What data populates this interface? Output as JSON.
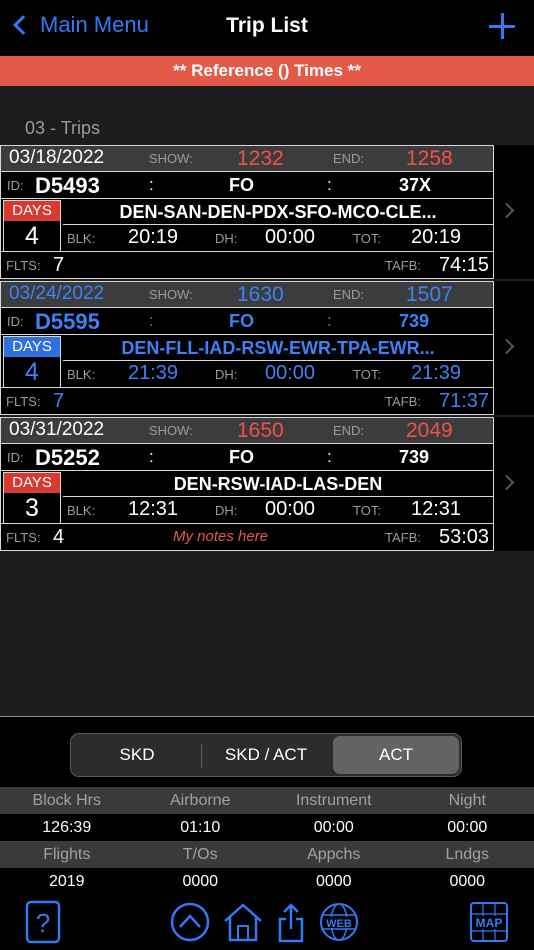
{
  "nav": {
    "back_label": "Main Menu",
    "title": "Trip List",
    "add_icon": "plus-icon"
  },
  "banner": "** Reference () Times **",
  "section_header": "03 - Trips",
  "trips": [
    {
      "date": "03/18/2022",
      "show_label": "SHOW:",
      "show": "1232",
      "end_label": "END:",
      "end": "1258",
      "id_label": "ID:",
      "id": "D5493",
      "colon": ":",
      "position": "FO",
      "equipment": "37X",
      "days_label": "DAYS",
      "days": "4",
      "route": "DEN-SAN-DEN-PDX-SFO-MCO-CLE...",
      "blk_label": "BLK:",
      "blk": "20:19",
      "dh_label": "DH:",
      "dh": "00:00",
      "tot_label": "TOT:",
      "tot": "20:19",
      "flts_label": "FLTS:",
      "flts": "7",
      "notes": "",
      "tafb_label": "TAFB:",
      "tafb": "74:15"
    },
    {
      "date": "03/24/2022",
      "show_label": "SHOW:",
      "show": "1630",
      "end_label": "END:",
      "end": "1507",
      "id_label": "ID:",
      "id": "D5595",
      "colon": ":",
      "position": "FO",
      "equipment": "739",
      "days_label": "DAYS",
      "days": "4",
      "route": "DEN-FLL-IAD-RSW-EWR-TPA-EWR...",
      "blk_label": "BLK:",
      "blk": "21:39",
      "dh_label": "DH:",
      "dh": "00:00",
      "tot_label": "TOT:",
      "tot": "21:39",
      "flts_label": "FLTS:",
      "flts": "7",
      "notes": "",
      "tafb_label": "TAFB:",
      "tafb": "71:37"
    },
    {
      "date": "03/31/2022",
      "show_label": "SHOW:",
      "show": "1650",
      "end_label": "END:",
      "end": "2049",
      "id_label": "ID:",
      "id": "D5252",
      "colon": ":",
      "position": "FO",
      "equipment": "739",
      "days_label": "DAYS",
      "days": "3",
      "route": "DEN-RSW-IAD-LAS-DEN",
      "blk_label": "BLK:",
      "blk": "12:31",
      "dh_label": "DH:",
      "dh": "00:00",
      "tot_label": "TOT:",
      "tot": "12:31",
      "flts_label": "FLTS:",
      "flts": "4",
      "notes": "My notes here",
      "tafb_label": "TAFB:",
      "tafb": "53:03"
    }
  ],
  "segmented": {
    "options": [
      "SKD",
      "SKD / ACT",
      "ACT"
    ],
    "selected": "ACT"
  },
  "stats": {
    "row1_headers": [
      "Block Hrs",
      "Airborne",
      "Instrument",
      "Night"
    ],
    "row1_values": [
      "126:39",
      "01:10",
      "00:00",
      "00:00"
    ],
    "row2_headers": [
      "Flights",
      "T/Os",
      "Appchs",
      "Lndgs"
    ],
    "row2_values": [
      "2019",
      "0000",
      "0000",
      "0000"
    ]
  },
  "toolbar": {
    "help_icon": "help-icon",
    "up_icon": "scroll-up-icon",
    "home_icon": "home-icon",
    "share_icon": "share-icon",
    "web_label": "WEB",
    "map_label": "MAP"
  },
  "colors": {
    "accent": "#2f7bf5",
    "banner": "#e35a48",
    "red_value": "#ef5245",
    "blue_value": "#3b82f6"
  }
}
